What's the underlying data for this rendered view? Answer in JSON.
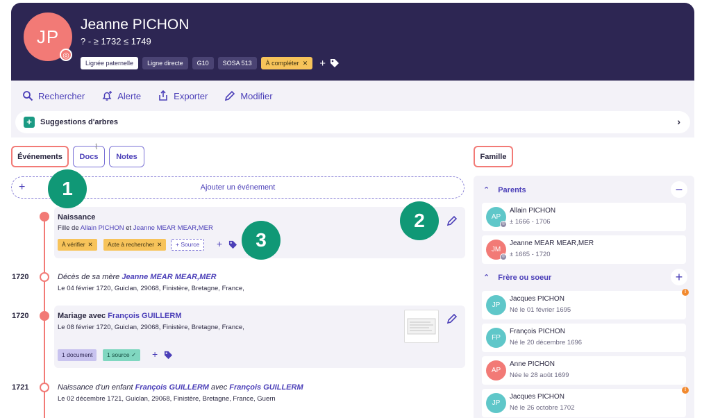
{
  "person": {
    "initials": "JP",
    "name": "Jeanne PICHON",
    "dates": "? - ≥ 1732 ≤ 1749",
    "tags": [
      {
        "label": "Lignée paternelle"
      },
      {
        "label": "Ligne directe"
      },
      {
        "label": "G10"
      },
      {
        "label": "SOSA 513"
      },
      {
        "label": "À compléter"
      }
    ],
    "tag_remove_glyph": "✕",
    "tag_add_glyph": "+"
  },
  "toolbar": {
    "search_label": "Rechercher",
    "alert_label": "Alerte",
    "export_label": "Exporter",
    "edit_label": "Modifier",
    "suggestions_label": "Suggestions d'arbres"
  },
  "tabs": {
    "events": "Événements",
    "docs": "Docs",
    "notes": "Notes",
    "family": "Famille"
  },
  "add_event": {
    "plus": "+",
    "label": "Ajouter un événement"
  },
  "events": [
    {
      "year": "",
      "title": "Naissance",
      "sub_prefix": "Fille de ",
      "father": "Allain PICHON",
      "sub_joiner": " et ",
      "mother": "Jeanne MEAR MEAR,MER",
      "tags": [
        "À vérifier",
        "Acte à rechercher"
      ],
      "source_label": "+ Source"
    },
    {
      "year": "1720",
      "title_prefix": "Décès de sa mère ",
      "title_link": "Jeanne MEAR MEAR,MER",
      "details": "Le 04 février 1720, Guiclan, 29068, Finistère, Bretagne, France,"
    },
    {
      "year": "1720",
      "title_prefix": "Mariage avec ",
      "title_link": "François GUILLERM",
      "details": "Le 08 février 1720, Guiclan, 29068, Finistère, Bretagne, France,",
      "doc_tag": "1 document",
      "source_tag": "1 source",
      "source_check": "✓"
    },
    {
      "year": "1721",
      "title_prefix": "Naissance d'un enfant ",
      "title_link": "François GUILLERM",
      "title_joiner": " avec ",
      "title_link2": "François GUILLERM",
      "details": "Le 02 décembre 1721, Guiclan, 29068, Finistère, Bretagne, France, Guern"
    }
  ],
  "callouts": [
    "1",
    "2",
    "3"
  ],
  "family": {
    "parents_label": "Parents",
    "parents_toggle": "−",
    "siblings_label": "Frère ou soeur",
    "siblings_toggle": "+",
    "parents": [
      {
        "initials": "AP",
        "name": "Allain PICHON",
        "dates": "± 1666 - 1706"
      },
      {
        "initials": "JM",
        "name": "Jeanne MEAR MEAR,MER",
        "dates": "± 1665 - 1720"
      }
    ],
    "siblings": [
      {
        "initials": "JP",
        "name": "Jacques PICHON",
        "dates": "Né le 01 février 1695",
        "warn": "!"
      },
      {
        "initials": "FP",
        "name": "François PICHON",
        "dates": "Né le 20 décembre 1696"
      },
      {
        "initials": "AP",
        "name": "Anne PICHON",
        "dates": "Née le 28 août 1699"
      },
      {
        "initials": "JP",
        "name": "Jacques PICHON",
        "dates": "Né le 26 octobre 1702",
        "warn": "!"
      }
    ]
  },
  "colors": {
    "header_bg": "#2d2653",
    "accent": "#4b3fb8",
    "avatar_red": "#f27a76",
    "avatar_teal": "#5fc7c9",
    "callout_green": "#109876",
    "tag_yellow": "#f7c35a"
  }
}
